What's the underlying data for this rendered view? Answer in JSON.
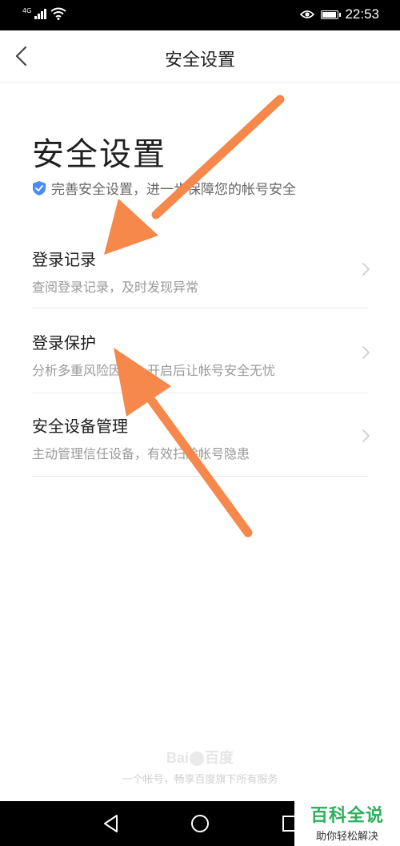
{
  "status_bar": {
    "network": "4G",
    "time": "22:53"
  },
  "header": {
    "title": "安全设置"
  },
  "page": {
    "heading": "安全设置",
    "subtitle": "完善安全设置，进一步保障您的帐号安全"
  },
  "menu": [
    {
      "title": "登录记录",
      "desc": "查阅登录记录，及时发现异常"
    },
    {
      "title": "登录保护",
      "desc": "分析多重风险因子，开启后让帐号安全无忧"
    },
    {
      "title": "安全设备管理",
      "desc": "主动管理信任设备，有效扫除帐号隐患"
    }
  ],
  "footer": {
    "logo_text_1": "Bai",
    "logo_text_2": "百度",
    "text": "一个帐号，畅享百度旗下所有服务"
  },
  "watermark": {
    "main": "百科全说",
    "sub": "助你轻松解决"
  },
  "colors": {
    "arrow": "#f5884a",
    "watermark_green": "#2bb15c",
    "shield_blue": "#4a8cf7"
  }
}
